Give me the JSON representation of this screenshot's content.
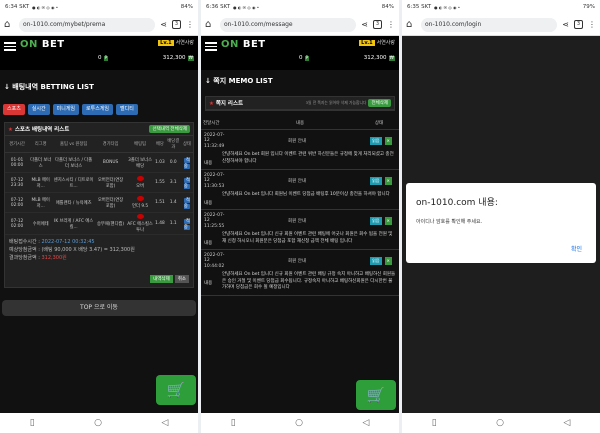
{
  "colors": {
    "brand_green": "#4caf50",
    "red_tab": "#d93636",
    "blue_tab": "#2d6cb5",
    "page_bg": "#111111",
    "link_blue": "#1a73e8"
  },
  "panels": [
    {
      "status": {
        "time": "6:34 SKT",
        "icons": "● ◐ ✉ ◎ ◉ •",
        "battery": "84%"
      },
      "url": "on-1010.com/mybet/prema",
      "header": {
        "logo_a": "ON",
        "logo_b": " BET",
        "level": "Lv.1",
        "user": "서연사랑",
        "points": "0",
        "points_tag": "P",
        "balance": "312,300",
        "balance_tag": "₩"
      },
      "section_title": "↓ 배팅내역 BETTING LIST",
      "tabs": [
        "스포츠",
        "실시간",
        "미니게임",
        "로투스게임",
        "벨디티"
      ],
      "box_title": "스포츠 배팅내역 리스트",
      "box_button": "선택내역 전체삭제",
      "columns": [
        "경기시간",
        "리그명",
        "홈팀 vs 원정팀",
        "경기타입",
        "배팅팀",
        "배당",
        "배당결과",
        "상태"
      ],
      "rows": [
        {
          "time": "01-01 00:00",
          "league": "다폴더 보너스",
          "teams": "다폴더 보너스 / 다폴더 보너스",
          "type": "BONUS",
          "pick": "3폴더 보너스배당",
          "odd": "1.03",
          "result": "0.0",
          "status": "적중"
        },
        {
          "time": "07-12 23:30",
          "league": "MLB 메이저...",
          "teams": "센지스시티 / 디트로이트...",
          "type": "오버언더(연장포함)",
          "pick": "오버",
          "odd": "1.55",
          "result": "3.1",
          "status": "적중"
        },
        {
          "time": "07-12 02:00",
          "league": "MLB 메이저...",
          "teams": "애틀랜타 / 뉴욕메츠",
          "type": "오버언더(연장포함)",
          "pick": "언더 9.5",
          "odd": "1.51",
          "result": "1.4",
          "status": "적중"
        },
        {
          "time": "07-12 02:00",
          "league": "수퍼에테",
          "teams": "IK 브라게 / AFC 에스킬...",
          "type": "승무패(핸디캡)",
          "pick": "AFC 에스킬스투나",
          "odd": "1.48",
          "result": "1.1",
          "status": "적중"
        }
      ],
      "summary": {
        "date_label": "배팅접수시간 :",
        "date": "2022-07-12 00:32:45",
        "bet_label": "예상당첨금액 :",
        "bet": "(배팅 90,000 X 배당 3.47) = 312,300원",
        "win_label": "결과당첨금액 :",
        "win": "312,300원"
      },
      "small_buttons": [
        "내역삭제",
        "취소"
      ],
      "top_button": "TOP 으로 이동"
    },
    {
      "status": {
        "time": "6:36 SKT",
        "icons": "● ◐ ✉ ◎ ◉ •",
        "battery": "84%"
      },
      "url": "on-1010.com/message",
      "header": {
        "logo_a": "ON",
        "logo_b": " BET",
        "level": "Lv.1",
        "user": "서연사랑",
        "points": "0",
        "points_tag": "P",
        "balance": "312,300",
        "balance_tag": "₩"
      },
      "section_title": "↓ 쪽지 MEMO LIST",
      "box_title": "쪽지 리스트",
      "box_note": "3일 전 쪽지는 읽어야 삭제 가능합니다",
      "box_button": "전체삭제",
      "columns": [
        "전달시간",
        "내용",
        "상태"
      ],
      "messages": [
        {
          "date": "2022-07-12",
          "time": "11:32:49",
          "title": "회원 안내",
          "read": "읽음",
          "label": "내용",
          "body": "안녕하세요 On bet 회원 입니다 이벤트 관련 위반 하신분들은 규정에 맞게 처리되셨고 충전 신청하셔야 합니다"
        },
        {
          "date": "2022-07-12",
          "time": "11:30:53",
          "title": "회원 안내",
          "read": "읽음",
          "label": "내용",
          "body": "안녕하세요 On bet 입니다 회원님 이벤트 당첨금 배팅후 10분이상 충전을 하셔야 합니다"
        },
        {
          "date": "2022-07-12",
          "time": "11:25:55",
          "title": "회원 안내",
          "read": "읽음",
          "label": "내용",
          "body": "안녕하세요 On bet 입니다 신규 회원 이벤트 관련 배팅에 어긋나 회원은 회수 됨을 전원 및 재 신청 하시오니 회원분은 당첨금 포함 재신청 금액 전체 배팅 입니다"
        },
        {
          "date": "2022-07-12",
          "time": "10:44:02",
          "title": "회원 안내",
          "read": "읽음",
          "label": "내용",
          "body": "안녕하세요 On bet 입니다 신규 회원 이벤트 관련 배팅 규정 숙지 아니하고 배팅하신 회원들은 승인 거절 및 이벤트 당첨금 회수됩니다. 규정숙지 아니하고 배팅하신회원은 다시한번 불가하며 당첨금은 회수 될 예정입니다"
        }
      ]
    },
    {
      "status": {
        "time": "6:35 SKT",
        "icons": "● ◐ ✉ ◎ ◉ •",
        "battery": "79%"
      },
      "url": "on-1010.com/login",
      "dialog": {
        "title": "on-1010.com 내용:",
        "message": "아이디나 암호를 확인해 주세요.",
        "ok": "확인"
      }
    }
  ]
}
